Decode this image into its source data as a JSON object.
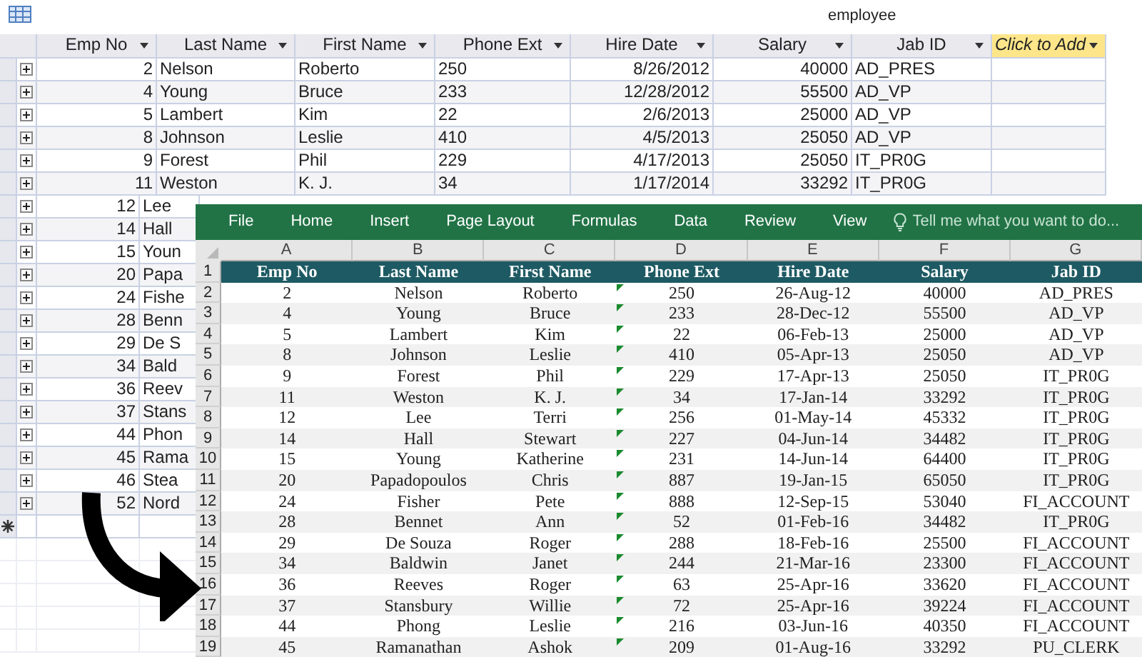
{
  "access": {
    "title": "employee",
    "columns": [
      {
        "label": "Emp No",
        "kind": "field"
      },
      {
        "label": "Last Name",
        "kind": "field"
      },
      {
        "label": "First Name",
        "kind": "field"
      },
      {
        "label": "Phone Ext",
        "kind": "field"
      },
      {
        "label": "Hire Date",
        "kind": "field"
      },
      {
        "label": "Salary",
        "kind": "field"
      },
      {
        "label": "Jab ID",
        "kind": "field"
      },
      {
        "label": "Click to Add",
        "kind": "add"
      }
    ],
    "rows": [
      [
        "2",
        "Nelson",
        "Roberto",
        "250",
        "8/26/2012",
        "40000",
        "AD_PRES"
      ],
      [
        "4",
        "Young",
        "Bruce",
        "233",
        "12/28/2012",
        "55500",
        "AD_VP"
      ],
      [
        "5",
        "Lambert",
        "Kim",
        "22",
        "2/6/2013",
        "25000",
        "AD_VP"
      ],
      [
        "8",
        "Johnson",
        "Leslie",
        "410",
        "4/5/2013",
        "25050",
        "AD_VP"
      ],
      [
        "9",
        "Forest",
        "Phil",
        "229",
        "4/17/2013",
        "25050",
        "IT_PR0G"
      ],
      [
        "11",
        "Weston",
        "K. J.",
        "34",
        "1/17/2014",
        "33292",
        "IT_PR0G"
      ]
    ],
    "covered_rows": [
      [
        "12",
        "Lee"
      ],
      [
        "14",
        "Hall"
      ],
      [
        "15",
        "Youn"
      ],
      [
        "20",
        "Papa"
      ],
      [
        "24",
        "Fishe"
      ],
      [
        "28",
        "Benn"
      ],
      [
        "29",
        "De S"
      ],
      [
        "34",
        "Bald"
      ],
      [
        "36",
        "Reev"
      ],
      [
        "37",
        "Stans"
      ],
      [
        "44",
        "Phon"
      ],
      [
        "45",
        "Rama"
      ],
      [
        "46",
        "Stea"
      ],
      [
        "52",
        "Nord"
      ]
    ]
  },
  "excel": {
    "ribbon_tabs": [
      "File",
      "Home",
      "Insert",
      "Page Layout",
      "Formulas",
      "Data",
      "Review",
      "View"
    ],
    "tell_me": "Tell me what you want to do...",
    "column_letters": [
      "A",
      "B",
      "C",
      "D",
      "E",
      "F",
      "G"
    ],
    "header_row": {
      "number": "1",
      "cells": [
        "Emp No",
        "Last Name",
        "First Name",
        "Phone Ext",
        "Hire Date",
        "Salary",
        "Jab ID"
      ]
    },
    "rows": [
      {
        "number": "2",
        "cells": [
          "2",
          "Nelson",
          "Roberto",
          "250",
          "26-Aug-12",
          "40000",
          "AD_PRES"
        ]
      },
      {
        "number": "3",
        "cells": [
          "4",
          "Young",
          "Bruce",
          "233",
          "28-Dec-12",
          "55500",
          "AD_VP"
        ]
      },
      {
        "number": "4",
        "cells": [
          "5",
          "Lambert",
          "Kim",
          "22",
          "06-Feb-13",
          "25000",
          "AD_VP"
        ]
      },
      {
        "number": "5",
        "cells": [
          "8",
          "Johnson",
          "Leslie",
          "410",
          "05-Apr-13",
          "25050",
          "AD_VP"
        ]
      },
      {
        "number": "6",
        "cells": [
          "9",
          "Forest",
          "Phil",
          "229",
          "17-Apr-13",
          "25050",
          "IT_PR0G"
        ]
      },
      {
        "number": "7",
        "cells": [
          "11",
          "Weston",
          "K. J.",
          "34",
          "17-Jan-14",
          "33292",
          "IT_PR0G"
        ]
      },
      {
        "number": "8",
        "cells": [
          "12",
          "Lee",
          "Terri",
          "256",
          "01-May-14",
          "45332",
          "IT_PR0G"
        ]
      },
      {
        "number": "9",
        "cells": [
          "14",
          "Hall",
          "Stewart",
          "227",
          "04-Jun-14",
          "34482",
          "IT_PR0G"
        ]
      },
      {
        "number": "10",
        "cells": [
          "15",
          "Young",
          "Katherine",
          "231",
          "14-Jun-14",
          "64400",
          "IT_PR0G"
        ]
      },
      {
        "number": "11",
        "cells": [
          "20",
          "Papadopoulos",
          "Chris",
          "887",
          "19-Jan-15",
          "65050",
          "IT_PR0G"
        ]
      },
      {
        "number": "12",
        "cells": [
          "24",
          "Fisher",
          "Pete",
          "888",
          "12-Sep-15",
          "53040",
          "FI_ACCOUNT"
        ]
      },
      {
        "number": "13",
        "cells": [
          "28",
          "Bennet",
          "Ann",
          "52",
          "01-Feb-16",
          "34482",
          "IT_PR0G"
        ]
      },
      {
        "number": "14",
        "cells": [
          "29",
          "De Souza",
          "Roger",
          "288",
          "18-Feb-16",
          "25500",
          "FI_ACCOUNT"
        ]
      },
      {
        "number": "15",
        "cells": [
          "34",
          "Baldwin",
          "Janet",
          "244",
          "21-Mar-16",
          "23300",
          "FI_ACCOUNT"
        ]
      },
      {
        "number": "16",
        "cells": [
          "36",
          "Reeves",
          "Roger",
          "63",
          "25-Apr-16",
          "33620",
          "FI_ACCOUNT"
        ]
      },
      {
        "number": "17",
        "cells": [
          "37",
          "Stansbury",
          "Willie",
          "72",
          "25-Apr-16",
          "39224",
          "FI_ACCOUNT"
        ]
      },
      {
        "number": "18",
        "cells": [
          "44",
          "Phong",
          "Leslie",
          "216",
          "03-Jun-16",
          "40350",
          "FI_ACCOUNT"
        ]
      },
      {
        "number": "19",
        "cells": [
          "45",
          "Ramanathan",
          "Ashok",
          "209",
          "01-Aug-16",
          "33292",
          "PU_CLERK"
        ]
      }
    ]
  }
}
